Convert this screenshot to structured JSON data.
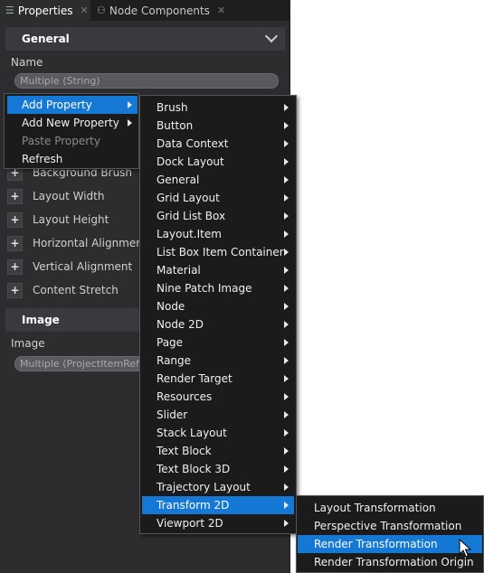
{
  "tabs": [
    {
      "label": "Properties",
      "icon": "list-icon",
      "active": true
    },
    {
      "label": "Node Components",
      "icon": "component-icon",
      "active": false
    }
  ],
  "tab_close_glyph": "✕",
  "general": {
    "header": "General",
    "name_label": "Name",
    "name_value": "Multiple (String)"
  },
  "properties": [
    {
      "label": "Background Brush"
    },
    {
      "label": "Layout Width"
    },
    {
      "label": "Layout Height"
    },
    {
      "label": "Horizontal Alignment"
    },
    {
      "label": "Vertical Alignment"
    },
    {
      "label": "Content Stretch"
    }
  ],
  "plus_glyph": "+",
  "image_section": {
    "header": "Image",
    "image_label": "Image",
    "image_value": "Multiple (ProjectItemRefe"
  },
  "context_menu": [
    {
      "label": "Add Property",
      "highlighted": true,
      "submenu": true
    },
    {
      "label": "Add New Property",
      "submenu": true
    },
    {
      "label": "Paste Property",
      "disabled": true
    },
    {
      "label": "Refresh"
    }
  ],
  "category_menu": [
    "Brush",
    "Button",
    "Data Context",
    "Dock Layout",
    "General",
    "Grid Layout",
    "Grid List Box",
    "Layout.Item",
    "List Box Item Container",
    "Material",
    "Nine Patch Image",
    "Node",
    "Node 2D",
    "Page",
    "Range",
    "Render Target",
    "Resources",
    "Slider",
    "Stack Layout",
    "Text Block",
    "Text Block 3D",
    "Trajectory Layout",
    "Transform 2D",
    "Viewport 2D"
  ],
  "category_highlighted": "Transform 2D",
  "transform_menu": [
    "Layout Transformation",
    "Perspective Transformation",
    "Render Transformation",
    "Render Transformation Origin"
  ],
  "transform_highlighted": "Render Transformation",
  "colors": {
    "panel_bg": "#2d2d30",
    "menu_bg": "#1b1b1c",
    "highlight": "#1478d4"
  }
}
